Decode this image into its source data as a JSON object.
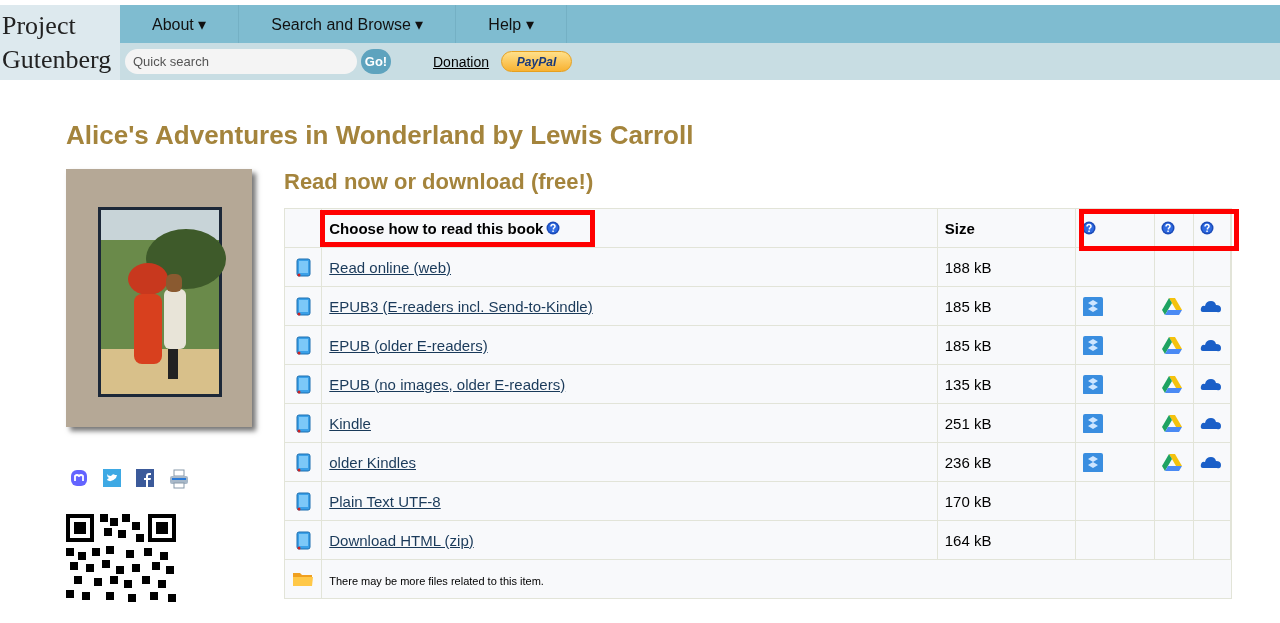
{
  "logo": {
    "line_1": "Project",
    "line_2": "Gutenberg"
  },
  "nav": [
    {
      "label": "About",
      "caret": "▾"
    },
    {
      "label": "Search and Browse",
      "caret": "▾"
    },
    {
      "label": "Help",
      "caret": "▾"
    }
  ],
  "search": {
    "placeholder": "Quick search",
    "button": "Go!"
  },
  "donation": "Donation",
  "paypal": "PayPal",
  "title": "Alice's Adventures in Wonderland by Lewis Carroll",
  "section_title": "Read now or download (free!)",
  "table": {
    "columns": [
      {
        "label": "Choose how to read this book",
        "help": true,
        "highlighted": true
      },
      {
        "label": "Size"
      }
    ],
    "service_help": {
      "highlighted": true
    },
    "rows": [
      {
        "kind": "file",
        "label": "Read online (web)",
        "size": "188 kB",
        "services": false
      },
      {
        "kind": "file",
        "label": "EPUB3 (E-readers incl. Send-to-Kindle)",
        "size": "185 kB",
        "services": true
      },
      {
        "kind": "file",
        "label": "EPUB (older E-readers)",
        "size": "185 kB",
        "services": true
      },
      {
        "kind": "file",
        "label": "EPUB (no images, older E-readers)",
        "size": "135 kB",
        "services": true
      },
      {
        "kind": "file",
        "label": "Kindle",
        "size": "251 kB",
        "services": true
      },
      {
        "kind": "file",
        "label": "older Kindles",
        "size": "236 kB",
        "services": true
      },
      {
        "kind": "file",
        "label": "Plain Text UTF-8",
        "size": "170 kB",
        "services": false
      },
      {
        "kind": "file",
        "label": "Download HTML (zip)",
        "size": "164 kB",
        "services": false
      },
      {
        "kind": "note",
        "label": "There may be more files related to this item."
      }
    ]
  }
}
